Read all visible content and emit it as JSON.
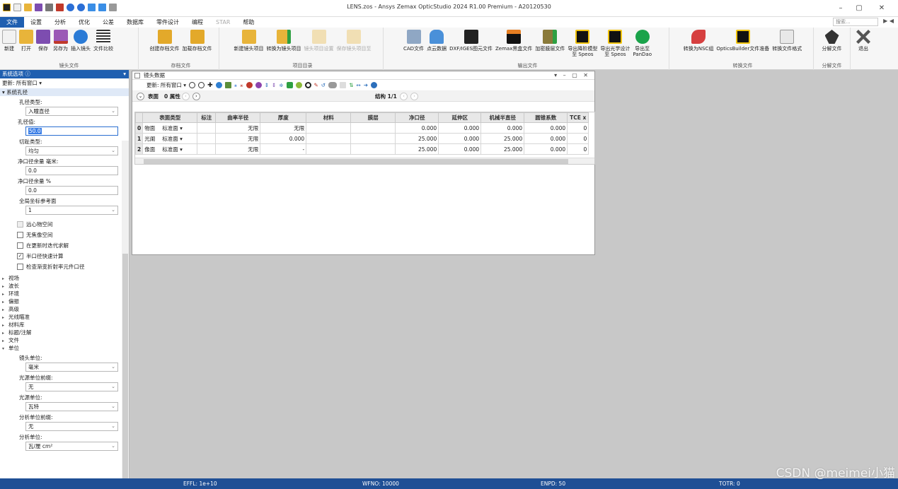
{
  "window": {
    "title": "LENS.zos - Ansys Zemax OpticStudio 2024 R1.00   Premium - A20120530",
    "controls": [
      "–",
      "▢",
      "✕"
    ]
  },
  "menu": {
    "items": [
      "文件",
      "设置",
      "分析",
      "优化",
      "公差",
      "数据库",
      "零件设计",
      "编程",
      "STAR",
      "帮助"
    ],
    "search_placeholder": "搜索...",
    "nav": "▶ ◀"
  },
  "ribbon": {
    "groups": [
      {
        "label": "镜头文件",
        "buttons": [
          "新建",
          "打开",
          "保存",
          "另存为",
          "插入镜头",
          "文件比较"
        ]
      },
      {
        "label": "存档文件",
        "buttons": [
          "创建存档文件",
          "加载存档文件"
        ]
      },
      {
        "label": "项目目录",
        "buttons": [
          "新建镜头项目",
          "转换为镜头项目",
          "镜头项目设置",
          "保存镜头项目至"
        ]
      },
      {
        "label": "输出文件",
        "buttons": [
          "CAD文件",
          "点云数据",
          "DXF/IGES图元文件",
          "Zemax黑盒文件",
          "加密膜层文件",
          "导出降阶模型\n至 Speos",
          "导出光学设计\n至 Speos",
          "导出至\nPanDao"
        ]
      },
      {
        "label": "转换文件",
        "buttons": [
          "转换为NSC组",
          "OpticsBuilder文件准备",
          "转换文件格式"
        ]
      },
      {
        "label": "分解文件",
        "buttons": [
          "分解文件"
        ]
      },
      {
        "label": "",
        "buttons": [
          "退出"
        ]
      }
    ],
    "colors": {
      "new": "#f2f2f2",
      "open": "#e8b43a",
      "save": "#7d4db0",
      "saveas": "#c0392b",
      "insert": "#2b7bd6",
      "compare": "#333333",
      "archive": "#e3a92a",
      "project": "#e8b43a",
      "cad": "#4a90d9",
      "dxf": "#222222",
      "speos": "#111111",
      "pandao": "#1aa34a",
      "nsc": "#d64040",
      "ob": "#111111",
      "exit": "#555555"
    }
  },
  "left_panel": {
    "header": "系统选项 ⓘ",
    "update": "更新: 所有窗口 ▾",
    "section": "系统孔径",
    "fields": [
      {
        "label": "孔径类型:",
        "type": "select",
        "value": "入瞳直径"
      },
      {
        "label": "孔径值:",
        "type": "input",
        "value": "50.0",
        "focus": true
      },
      {
        "label": "切趾类型:",
        "type": "select",
        "value": "均匀"
      },
      {
        "label": "净口径余量 毫米:",
        "type": "input",
        "value": "0.0"
      },
      {
        "label": "净口径余量 %",
        "type": "input",
        "value": "0.0"
      },
      {
        "label": "全局坐标参考面",
        "type": "select",
        "value": "1"
      }
    ],
    "checks": [
      {
        "label": "远心物空间",
        "checked": false,
        "disabled": true
      },
      {
        "label": "无焦像空间",
        "checked": false,
        "disabled": false
      },
      {
        "label": "在更新时迭代求解",
        "checked": false,
        "disabled": false
      },
      {
        "label": "半口径快速计算",
        "checked": true,
        "disabled": false
      },
      {
        "label": "检查渐变折射率元件口径",
        "checked": false,
        "disabled": false
      }
    ],
    "tree": [
      "视场",
      "波长",
      "环境",
      "偏振",
      "高级",
      "光线瞄准",
      "材料库",
      "标题/注解",
      "文件",
      "单位"
    ],
    "units_fields": [
      {
        "label": "镜头单位:",
        "value": "毫米"
      },
      {
        "label": "光源单位前缀:",
        "value": "无"
      },
      {
        "label": "光源单位:",
        "value": "瓦特"
      },
      {
        "label": "分析单位前缀:",
        "value": "无"
      },
      {
        "label": "分析单位:",
        "value": "瓦/厘 cm²"
      }
    ]
  },
  "lens_window": {
    "title": "镜头数据",
    "controls": "▾ – ▢ ✕",
    "update": "更新: 所有窗口 ▾",
    "surface_label": "表面",
    "props": "0 属性",
    "config": "结构 1/1",
    "columns": [
      "",
      "表面类型",
      "",
      "标注",
      "曲率半径",
      "",
      "厚度",
      "",
      "材料",
      "",
      "膜层",
      "",
      "净口径",
      "",
      "延伸区",
      "",
      "机械半直径",
      "",
      "圆锥系数",
      "",
      "TCE x"
    ],
    "rows": [
      {
        "no": "0",
        "name": "物面",
        "type": "标准面 ▾",
        "radius": "无限",
        "thickness": "无限",
        "material": "",
        "coating": "",
        "clear": "0.000",
        "chip": "0.000",
        "mech": "0.000",
        "conic": "0.000",
        "tce": "0"
      },
      {
        "no": "1",
        "name": "光阑",
        "type": "标准面 ▾",
        "radius": "无限",
        "thickness": "0.000",
        "material": "",
        "coating": "",
        "clear": "25.000",
        "chip": "0.000",
        "mech": "25.000",
        "conic": "0.000",
        "tce": "0"
      },
      {
        "no": "2",
        "name": "像面",
        "type": "标准面 ▾",
        "radius": "无限",
        "thickness": "-",
        "material": "",
        "coating": "",
        "clear": "25.000",
        "chip": "0.000",
        "mech": "25.000",
        "conic": "0.000",
        "tce": "0"
      }
    ]
  },
  "status": {
    "effl": "EFFL: 1e+10",
    "wfno": "WFNO: 10000",
    "enpd": "ENPD: 50",
    "totr": "TOTR: 0"
  },
  "watermark": "CSDN @meimei小猫"
}
